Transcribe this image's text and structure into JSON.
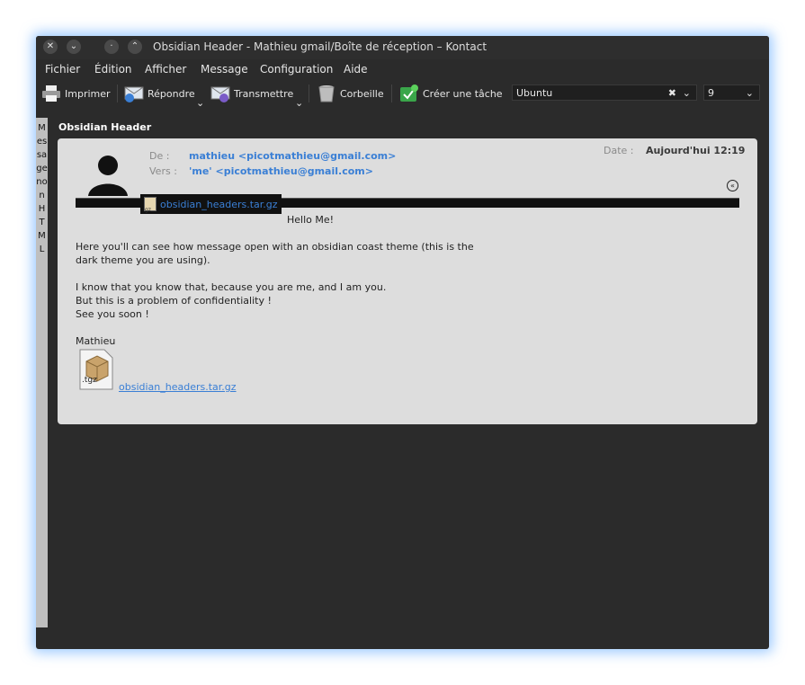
{
  "window": {
    "title": "Obsidian Header - Mathieu gmail/Boîte de réception – Kontact",
    "buttons": [
      "✕",
      "⌄",
      "·",
      "⌃"
    ]
  },
  "menu": [
    {
      "label": "Fichier"
    },
    {
      "label": "Édition"
    },
    {
      "label": "Afficher"
    },
    {
      "label": "Message"
    },
    {
      "label": "Configuration"
    },
    {
      "label": "Aide"
    }
  ],
  "toolbar": {
    "print_label": "Imprimer",
    "reply_label": "Répondre",
    "forward_label": "Transmettre",
    "trash_label": "Corbeille",
    "task_label": "Créer une tâche",
    "font_value": "Ubuntu",
    "size_value": "9"
  },
  "sidebar": {
    "vertical_text": "Message non HTML"
  },
  "message": {
    "subject": "Obsidian Header",
    "from_label": "De :",
    "from_value": "mathieu <picotmathieu@gmail.com>",
    "to_label": "Vers :",
    "to_value": "'me' <picotmathieu@gmail.com>",
    "date_label": "Date :",
    "date_value": "Aujourd'hui 12:19",
    "attachment_name": "obsidian_headers.tar.gz",
    "attachment_icon_text": "gz",
    "heading": "Hello Me!",
    "body": [
      "Here you'll can see how message open with an obsidian coast theme (this is the",
      "dark theme you are using).",
      "",
      "I know that you know that, because you are me, and I am you.",
      "But this is a problem of confidentiality !",
      "See you soon !",
      "",
      "Mathieu"
    ],
    "attachment_file_icon_label": ".tgz",
    "attachment_link": "obsidian_headers.tar.gz"
  },
  "colors": {
    "accent": "#3a7fd5",
    "window_bg": "#2b2b2b",
    "card_bg": "#dddddd",
    "glow": "#50a0ff"
  },
  "icons": [
    "close-icon",
    "minimize-icon",
    "maximize-icon",
    "keep-above-icon",
    "printer-icon",
    "reply-icon",
    "forward-icon",
    "trash-icon",
    "task-icon",
    "clear-icon",
    "chevron-down-icon",
    "collapse-icon",
    "avatar-icon",
    "archive-icon"
  ]
}
